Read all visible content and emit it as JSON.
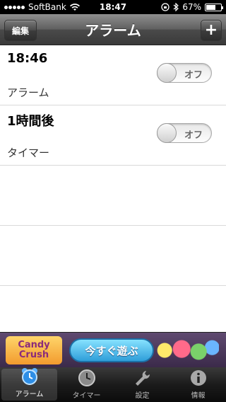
{
  "status_bar": {
    "carrier": "SoftBank",
    "time": "18:47",
    "battery": "67%",
    "battery_level": 0.67
  },
  "nav": {
    "title": "アラーム",
    "edit_label": "編集",
    "add_label": "+"
  },
  "alarms": [
    {
      "time": "18:46",
      "label": "アラーム",
      "toggle_text": "オフ"
    },
    {
      "time": "1時間後",
      "label": "タイマー",
      "toggle_text": "オフ"
    }
  ],
  "ad": {
    "logo_text": "Candy Crush",
    "cta": "今すぐ遊ぶ"
  },
  "tabs": [
    {
      "label": "アラーム",
      "icon": "alarm-clock-icon",
      "active": true
    },
    {
      "label": "タイマー",
      "icon": "timer-clock-icon",
      "active": false
    },
    {
      "label": "設定",
      "icon": "wrench-icon",
      "active": false
    },
    {
      "label": "情報",
      "icon": "info-icon",
      "active": false
    }
  ]
}
